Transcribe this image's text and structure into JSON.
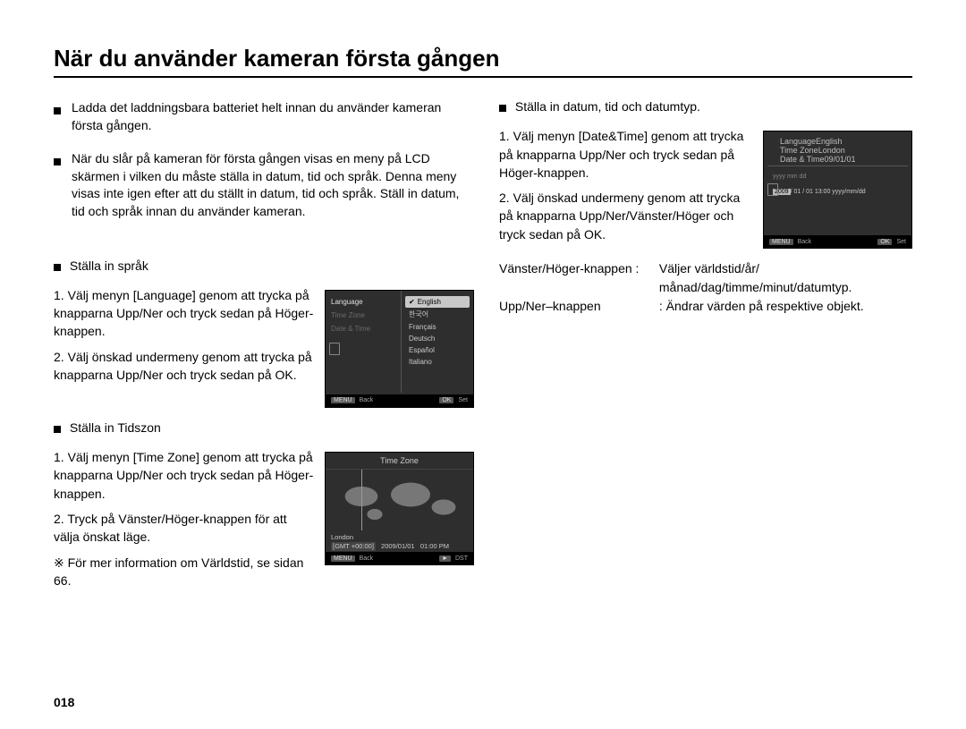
{
  "page_number": "018",
  "title": "När du använder kameran första gången",
  "intro_bullets": [
    "Ladda det laddningsbara batteriet helt innan du använder kameran första gången.",
    "När du slår på kameran för första gången visas en meny på LCD skärmen i vilken du måste ställa in datum, tid och språk. Denna meny visas inte igen efter att du ställt in datum, tid och språk. Ställ in datum, tid och språk innan du använder kameran."
  ],
  "lang": {
    "heading": "Ställa in språk",
    "steps": [
      "1. Välj menyn [Language] genom att trycka på knapparna Upp/Ner och tryck sedan på Höger-knappen.",
      "2. Välj önskad undermeny genom att trycka på knapparna Upp/Ner och tryck sedan på OK."
    ],
    "lcd": {
      "left_items": [
        "Language",
        "Time Zone",
        "Date & Time"
      ],
      "options": [
        "English",
        "한국어",
        "Français",
        "Deutsch",
        "Español",
        "Italiano"
      ],
      "selected": "English",
      "bar_left_btn": "MENU",
      "bar_left_txt": "Back",
      "bar_right_btn": "OK",
      "bar_right_txt": "Set"
    }
  },
  "tz": {
    "heading": "Ställa in Tidszon",
    "steps": [
      "1. Välj menyn [Time Zone] genom att trycka på knapparna Upp/Ner och tryck sedan på Höger-knappen.",
      "2. Tryck på Vänster/Höger-knappen för att välja önskat läge."
    ],
    "note": "※ För mer information om Världstid, se sidan 66.",
    "lcd": {
      "title": "Time Zone",
      "city": "London",
      "gmt": "[GMT +00:00]",
      "date": "2009/01/01",
      "time": "01:00 PM",
      "bar_left_btn": "MENU",
      "bar_left_txt": "Back",
      "bar_right_btn": "►",
      "bar_right_txt": "DST"
    }
  },
  "dt": {
    "heading": "Ställa in datum, tid och datumtyp.",
    "steps": [
      "1. Välj menyn [Date&Time] genom att trycka på knapparna Upp/Ner och tryck sedan på Höger-knappen.",
      "2. Välj önskad undermeny genom att trycka på knapparna Upp/Ner/Vänster/Höger och tryck sedan på OK."
    ],
    "kv": [
      {
        "k": "Vänster/Höger-knappen :",
        "v": "Väljer världstid/år/ månad/dag/timme/minut/datumtyp."
      },
      {
        "k": "Upp/Ner–knappen",
        "v": ": Ändrar värden på respektive objekt."
      }
    ],
    "lcd": {
      "left_items": [
        {
          "label": "Language",
          "val": "English"
        },
        {
          "label": "Time Zone",
          "val": "London"
        },
        {
          "label": "Date & Time",
          "val": "09/01/01"
        }
      ],
      "format_hint": "yyyy mm dd",
      "value_year": "2009",
      "value_rest": "/ 01 / 01   13:00   yyyy/mm/dd",
      "bar_left_btn": "MENU",
      "bar_left_txt": "Back",
      "bar_right_btn": "OK",
      "bar_right_txt": "Set"
    }
  }
}
